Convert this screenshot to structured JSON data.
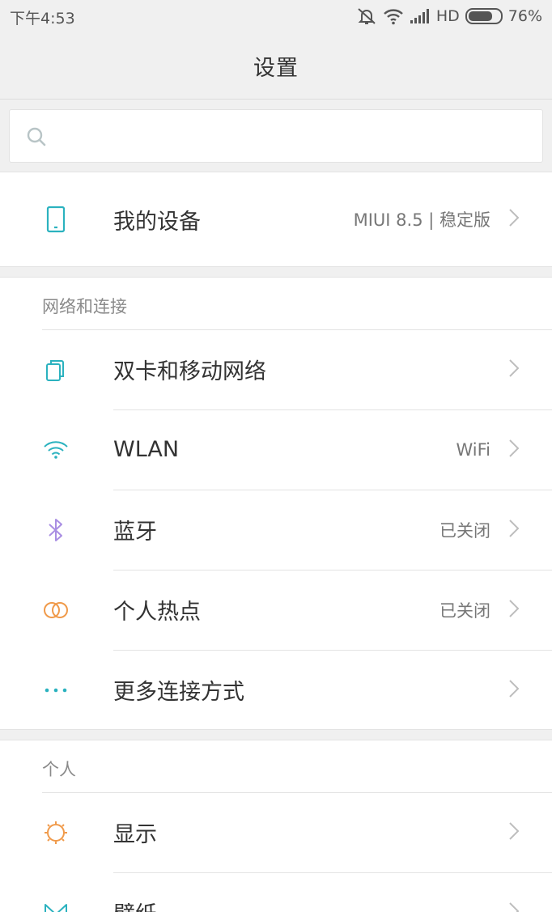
{
  "status_bar": {
    "time": "下午4:53",
    "network": "HD",
    "battery_percent": "76%",
    "battery_level": 0.76,
    "icons": [
      "mute-icon",
      "wifi-icon",
      "signal-icon",
      "battery-icon"
    ]
  },
  "header": {
    "title": "设置"
  },
  "search": {
    "placeholder": "",
    "value": ""
  },
  "device": {
    "label": "我的设备",
    "value": "MIUI 8.5 | 稳定版",
    "icon": "phone-icon"
  },
  "network_section": {
    "title": "网络和连接",
    "items": [
      {
        "label": "双卡和移动网络",
        "value": "",
        "icon": "sim-cards-icon"
      },
      {
        "label": "WLAN",
        "value": "WiFi",
        "icon": "wifi-icon"
      },
      {
        "label": "蓝牙",
        "value": "已关闭",
        "icon": "bluetooth-icon"
      },
      {
        "label": "个人热点",
        "value": "已关闭",
        "icon": "hotspot-icon"
      },
      {
        "label": "更多连接方式",
        "value": "",
        "icon": "more-dots-icon"
      }
    ]
  },
  "personal_section": {
    "title": "个人",
    "items": [
      {
        "label": "显示",
        "value": "",
        "icon": "sun-icon"
      },
      {
        "label": "壁纸",
        "value": "",
        "icon": "wallpaper-icon"
      }
    ]
  },
  "colors": {
    "background": "#f0f0f0",
    "teal": "#2bb2bf",
    "bluetooth": "#a98ee3",
    "orange": "#f09a4a",
    "text": "#333333",
    "secondary_text": "#777777"
  }
}
